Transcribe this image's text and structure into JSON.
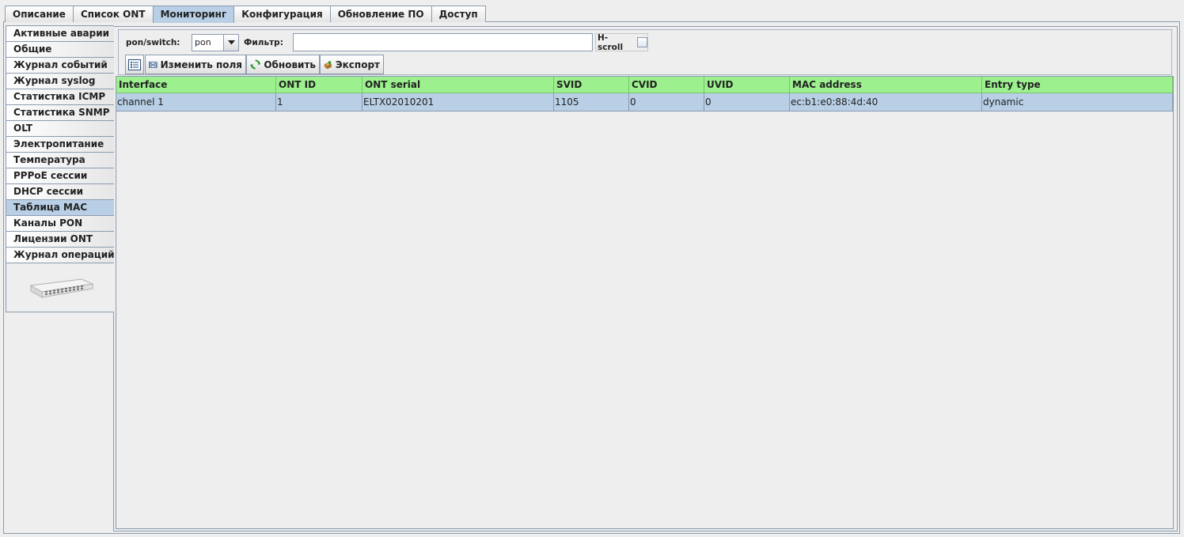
{
  "top_tabs": [
    {
      "label": "Описание"
    },
    {
      "label": "Список ONT"
    },
    {
      "label": "Мониторинг",
      "active": true
    },
    {
      "label": "Конфигурация"
    },
    {
      "label": "Обновление ПО"
    },
    {
      "label": "Доступ"
    }
  ],
  "side_tabs": [
    {
      "label": "Активные аварии"
    },
    {
      "label": "Общие"
    },
    {
      "label": "Журнал событий"
    },
    {
      "label": "Журнал syslog"
    },
    {
      "label": "Статистика ICMP"
    },
    {
      "label": "Статистика SNMP"
    },
    {
      "label": "OLT"
    },
    {
      "label": "Электропитание"
    },
    {
      "label": "Температура"
    },
    {
      "label": "PPPoE сессии"
    },
    {
      "label": "DHCP сессии"
    },
    {
      "label": "Таблица MAC",
      "active": true
    },
    {
      "label": "Каналы PON"
    },
    {
      "label": "Лицензии ONT"
    },
    {
      "label": "Журнал операций"
    }
  ],
  "toolbar": {
    "pon_switch_label": "pon/switch:",
    "pon_switch_value": "pon",
    "filter_label": "Фильтр:",
    "filter_value": "",
    "hscroll_label": "H-scroll",
    "hscroll_checked": false,
    "edit_fields_label": "Изменить поля",
    "refresh_label": "Обновить",
    "export_label": "Экспорт"
  },
  "table": {
    "columns": [
      "Interface",
      "ONT ID",
      "ONT serial",
      "SVID",
      "CVID",
      "UVID",
      "MAC address",
      "Entry type"
    ],
    "rows": [
      [
        "channel 1",
        "1",
        "ELTX02010201",
        "1105",
        "0",
        "0",
        "ec:b1:e0:88:4d:40",
        "dynamic"
      ]
    ]
  },
  "colors": {
    "header_bg": "#9cf08e",
    "selected_bg": "#b8cfe5",
    "border": "#8a9bb0",
    "panel_bg": "#eeeeee"
  }
}
